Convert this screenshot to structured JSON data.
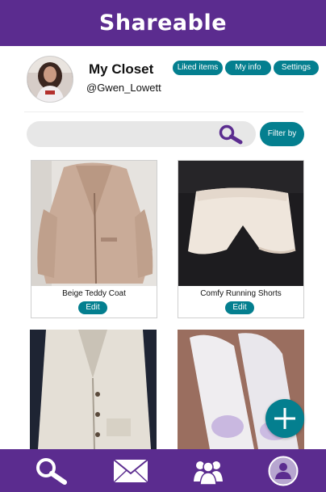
{
  "header": {
    "title": "Shareable"
  },
  "profile": {
    "closet_title": "My Closet",
    "username": "@Gwen_Lowett",
    "avatar_icon": "user-photo-avatar"
  },
  "actions": {
    "liked_items": "Liked items",
    "my_info": "My info",
    "settings": "Settings"
  },
  "search": {
    "placeholder": "",
    "value": "",
    "icon": "search-icon"
  },
  "filter": {
    "label": "Filter by"
  },
  "items": [
    {
      "name": "Beige Teddy Coat",
      "edit_label": "Edit"
    },
    {
      "name": "Comfy Running Shorts",
      "edit_label": "Edit"
    }
  ],
  "fab": {
    "icon": "plus-icon"
  },
  "bottom_nav": [
    {
      "icon": "search-icon"
    },
    {
      "icon": "mail-icon"
    },
    {
      "icon": "people-icon"
    },
    {
      "icon": "profile-icon"
    }
  ],
  "colors": {
    "primary_purple": "#5b2c8f",
    "accent_teal": "#047f8f",
    "search_bg": "#e7e7e7"
  }
}
